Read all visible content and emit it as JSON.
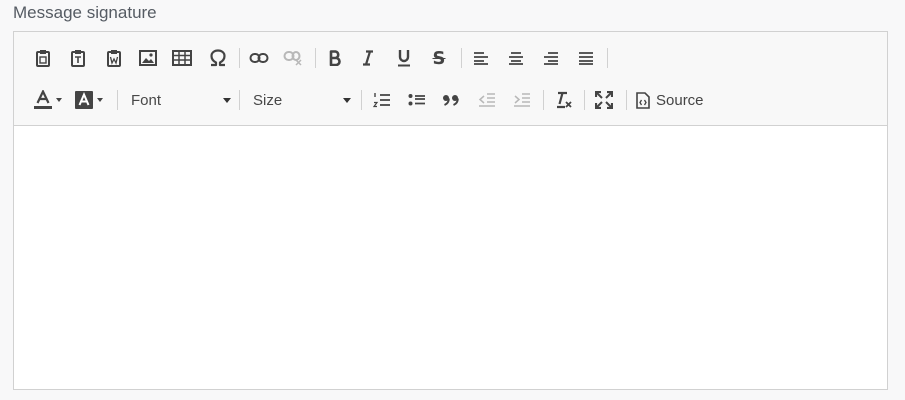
{
  "field": {
    "label": "Message signature"
  },
  "toolbar": {
    "strike_label": "S",
    "font_combo": {
      "label": "Font"
    },
    "size_combo": {
      "label": "Size"
    },
    "source": {
      "label": "Source"
    }
  },
  "editor": {
    "content": ""
  },
  "colors": {
    "page_bg": "#f8f8f9",
    "toolbar_bg": "#f8f8f8",
    "border": "#d1d1d1",
    "icon": "#444444",
    "label": "#555b63"
  }
}
